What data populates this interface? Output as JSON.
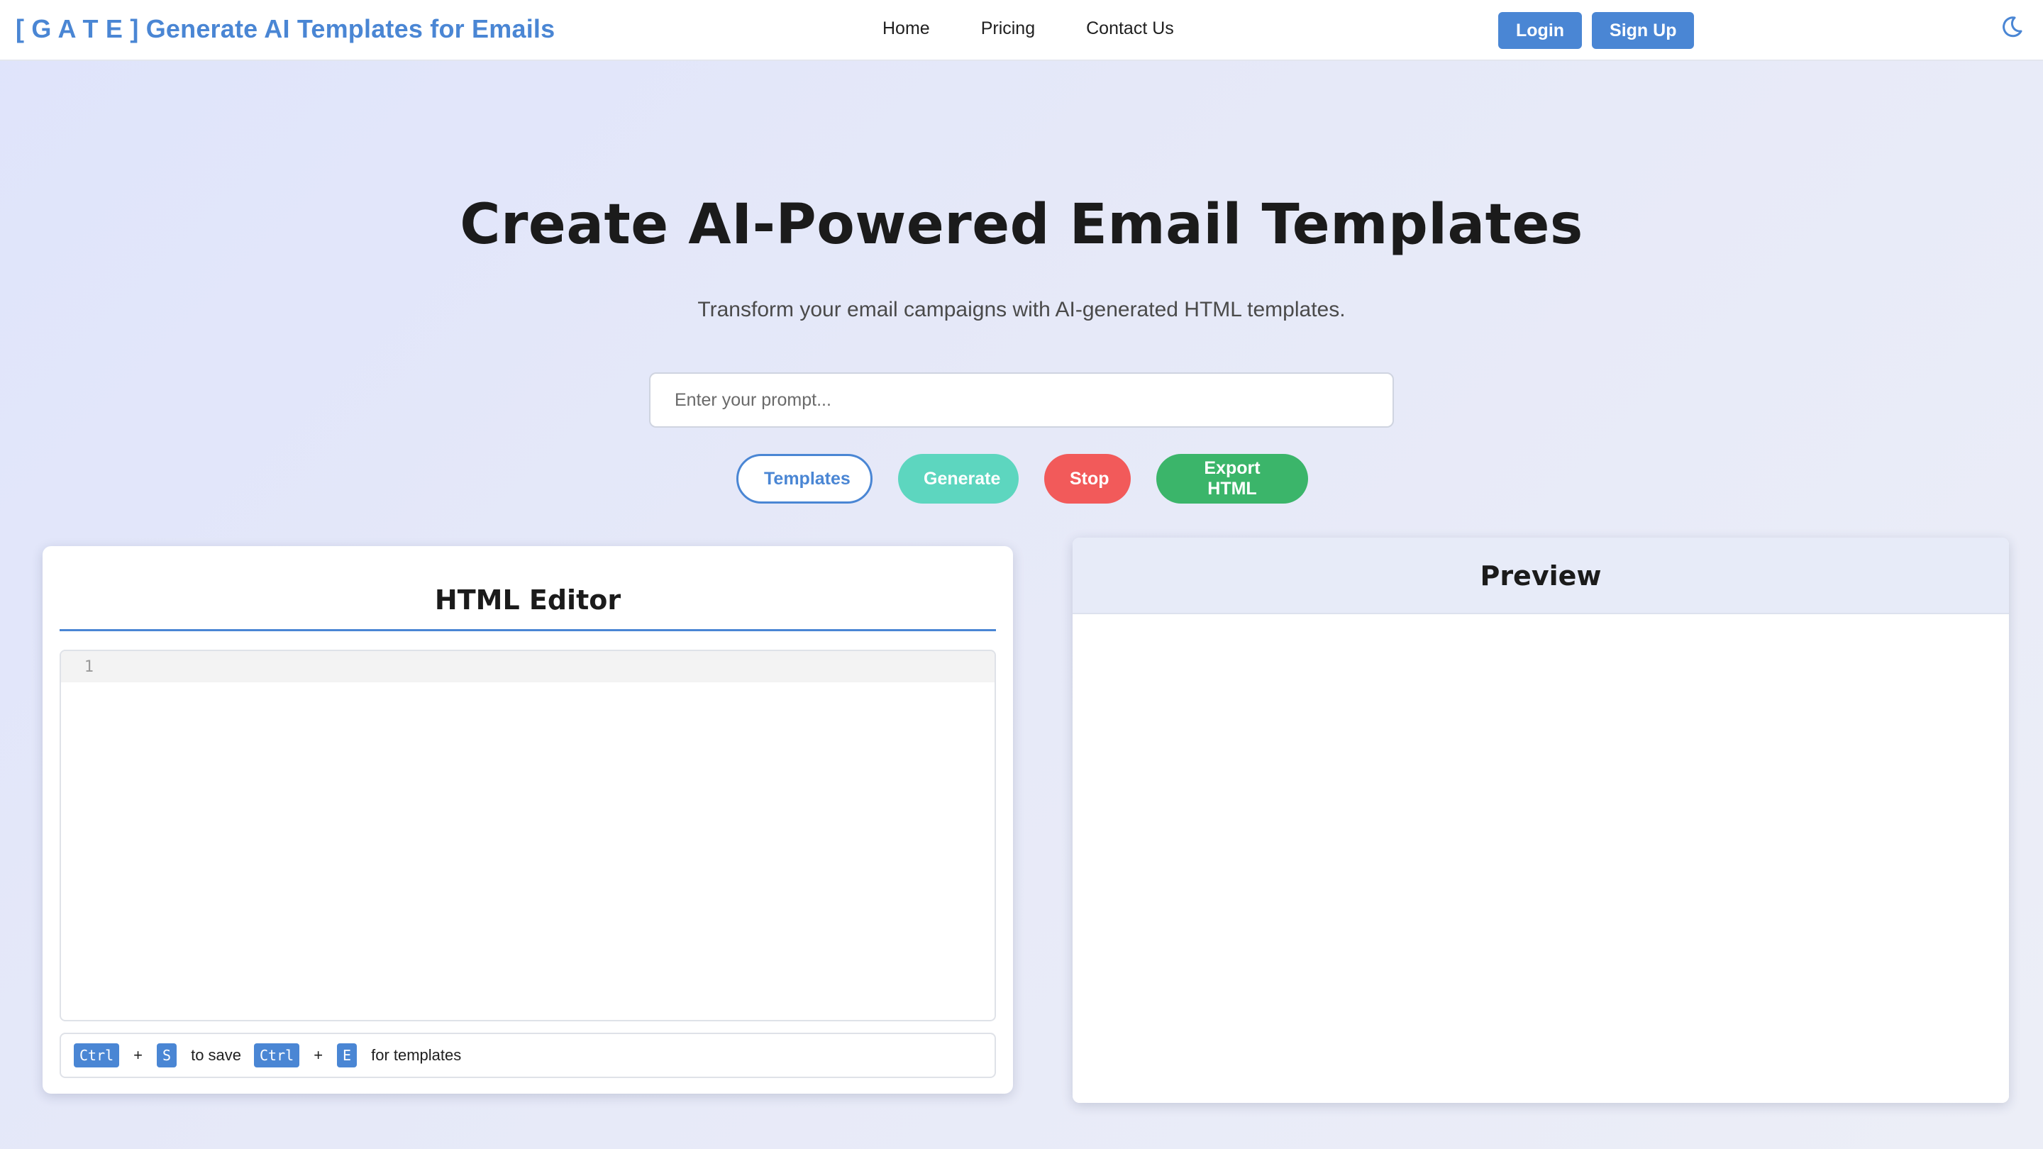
{
  "navbar": {
    "brand": "[ G A T E ] Generate AI Templates for Emails",
    "links": [
      "Home",
      "Pricing",
      "Contact Us"
    ],
    "login_label": "Login",
    "signup_label": "Sign Up",
    "theme_icon": "moon-icon"
  },
  "hero": {
    "title": "Create AI-Powered Email Templates",
    "subtitle": "Transform your email campaigns with AI-generated HTML templates.",
    "prompt_placeholder": "Enter your prompt...",
    "prompt_value": ""
  },
  "actions": {
    "templates_label": "Templates",
    "generate_label": "Generate",
    "stop_label": "Stop",
    "export_label": "Export HTML"
  },
  "editor": {
    "title": "HTML Editor",
    "line_numbers": [
      "1"
    ],
    "content": "",
    "shortcuts": {
      "key_ctrl": "Ctrl",
      "plus": "+",
      "key_s": "S",
      "save_text": "to save",
      "key_e": "E",
      "templates_text": "for templates"
    }
  },
  "preview": {
    "title": "Preview"
  },
  "colors": {
    "accent": "#4a86d4",
    "generate": "#5dd6bf",
    "stop": "#f25a5a",
    "export": "#3bb56a"
  }
}
